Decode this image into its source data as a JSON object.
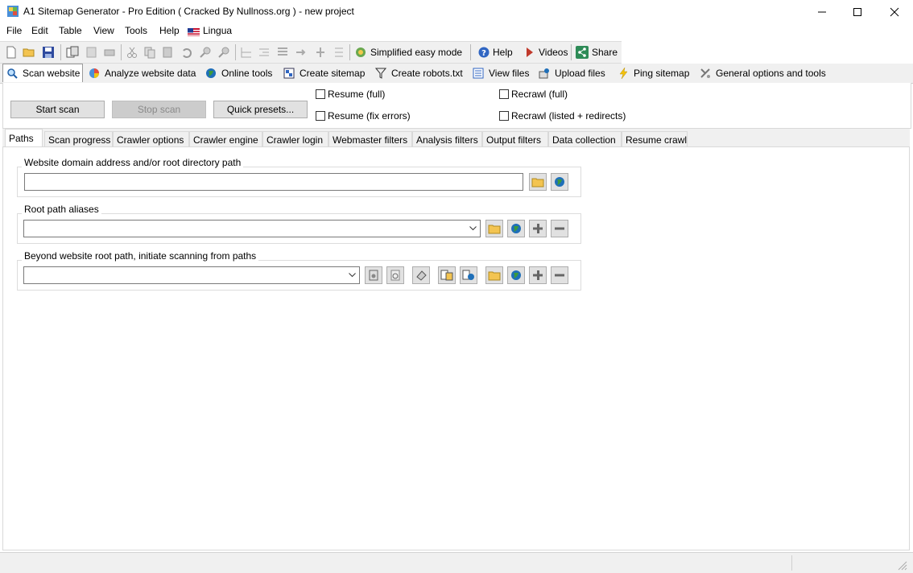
{
  "window": {
    "title": "A1 Sitemap Generator  - Pro Edition (    Cracked By Nullnoss.org   ) - new project"
  },
  "menu": [
    "File",
    "Edit",
    "Table",
    "View",
    "Tools",
    "Help",
    "Lingua"
  ],
  "toolbar": {
    "simplified_mode": "Simplified easy mode",
    "help": "Help",
    "videos": "Videos",
    "share": "Share"
  },
  "main_tabs": [
    "Scan website",
    "Analyze website data",
    "Online tools",
    "Create sitemap",
    "Create robots.txt",
    "View files",
    "Upload files",
    "Ping sitemap",
    "General options and tools"
  ],
  "controls": {
    "start_scan": "Start scan",
    "stop_scan": "Stop scan",
    "quick_presets": "Quick presets...",
    "resume_full": "Resume (full)",
    "resume_fix_errors": "Resume (fix errors)",
    "recrawl_full": "Recrawl (full)",
    "recrawl_listed": "Recrawl (listed + redirects)"
  },
  "sub_tabs": [
    "Paths",
    "Scan progress",
    "Crawler options",
    "Crawler engine",
    "Crawler login",
    "Webmaster filters",
    "Analysis filters",
    "Output filters",
    "Data collection",
    "Resume crawl"
  ],
  "groups": {
    "domain": {
      "title": "Website domain address and/or root directory path",
      "value": ""
    },
    "aliases": {
      "title": "Root path aliases",
      "value": ""
    },
    "beyond": {
      "title": "Beyond website root path, initiate scanning from paths",
      "value": ""
    }
  },
  "colors": {
    "accent_folder": "#f3c451",
    "globe_blue": "#1f6fb8",
    "globe_green": "#3c9a3c",
    "disabled_bg": "#cccccc"
  }
}
